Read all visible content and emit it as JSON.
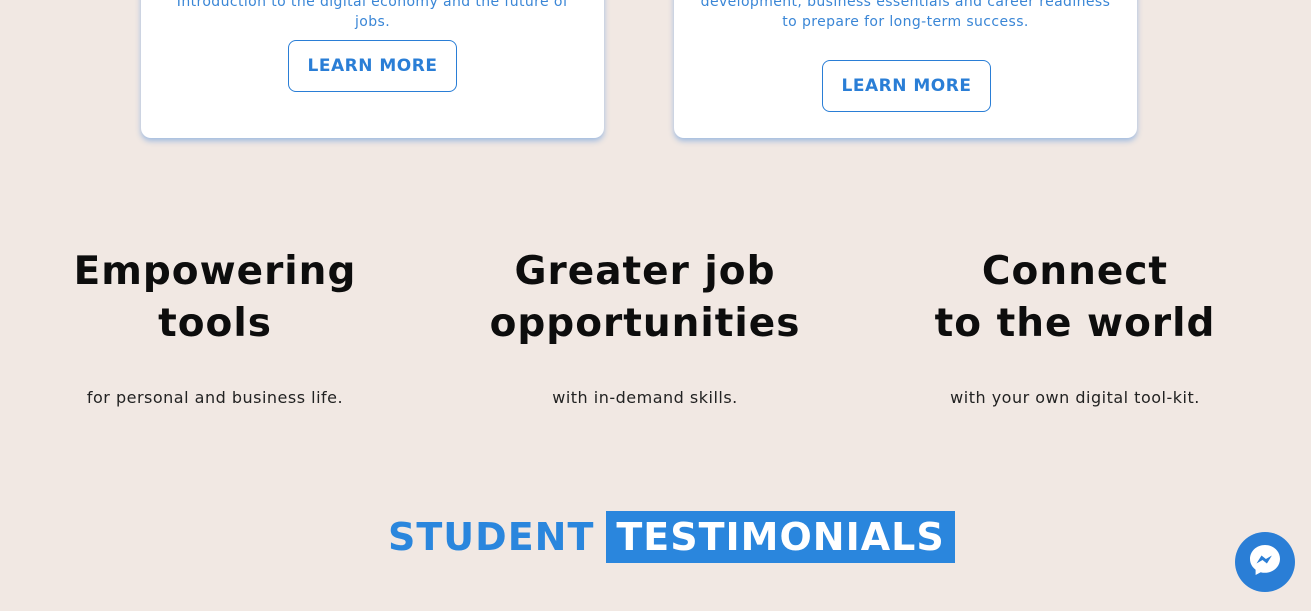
{
  "cards": [
    {
      "text": "Introduction to the digital economy and the future of jobs.",
      "button_label": "LEARN MORE"
    },
    {
      "text": "development, business essentials and career readiness to prepare for long-term success.",
      "button_label": "LEARN MORE"
    }
  ],
  "features": [
    {
      "title": "Empowering\ntools",
      "subtitle": "for personal and business life."
    },
    {
      "title": "Greater job\nopportunities",
      "subtitle": "with in-demand skills."
    },
    {
      "title": "Connect\nto the world",
      "subtitle": "with your own digital tool-kit."
    }
  ],
  "testimonials": {
    "word1": "STUDENT",
    "word2": "TESTIMONIALS"
  },
  "messenger": {
    "icon": "messenger-icon"
  },
  "colors": {
    "background": "#f1e8e3",
    "accent": "#2a86dd"
  }
}
